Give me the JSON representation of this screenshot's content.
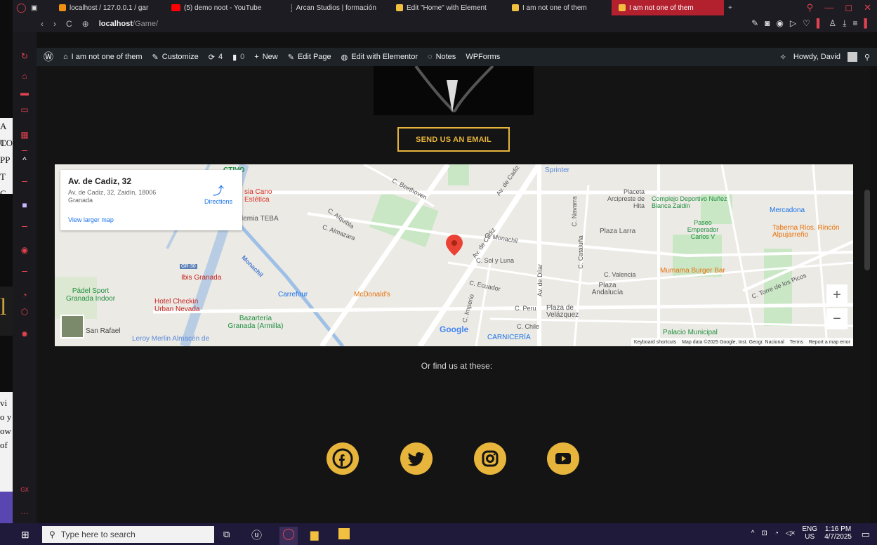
{
  "browser": {
    "tabs": [
      {
        "label": "localhost / 127.0.0.1 / gar",
        "color": "#f29111"
      },
      {
        "label": "(5) demo noot - YouTube",
        "color": "#ff0000"
      },
      {
        "label": "Arcan Studios | formación",
        "color": "#333333"
      },
      {
        "label": "Edit \"Home\" with Element",
        "color": "#f2c040"
      },
      {
        "label": "I am not one of them",
        "color": "#f2c040"
      },
      {
        "label": "I am not one of them",
        "color": "#f2c040",
        "active": true
      }
    ],
    "address": {
      "host": "localhost",
      "path": "/Game/"
    }
  },
  "wp_admin_bar": {
    "site_name": "I am not one of them",
    "customize": "Customize",
    "updates": "4",
    "comments": "0",
    "new": "New",
    "edit_page": "Edit Page",
    "edit_elementor": "Edit with Elementor",
    "notes": "Notes",
    "wpforms": "WPForms",
    "howdy": "Howdy, David"
  },
  "page": {
    "email_button": "SEND US AN EMAIL",
    "find_us": "Or find us at these:"
  },
  "map": {
    "place_title": "Av. de Cadiz, 32",
    "place_address": "Av. de Cadiz, 32, Zaidín, 18006 Granada",
    "directions": "Directions",
    "view_larger": "View larger map",
    "labels": {
      "sprinter": "Sprinter",
      "placeta": "Placeta Arcipreste de Hita",
      "complejo": "Complejo Deportivo Nuñez Blanca Zaidín",
      "mercadona": "Mercadona",
      "paseo": "Paseo Emperador Carlos V",
      "taberna": "Taberna Rios. Rincón Alpujarreño",
      "plaza_larra": "Plaza Larra",
      "mumama": "Mumama Burger Bar",
      "estetica": "sia Cano Estética",
      "teba": "lemia TEBA",
      "ibis": "Ibis Granada",
      "padel": "Pádel Sport Granada Indoor",
      "hotel": "Hotel Checkin Urban Nevada",
      "carrefour": "Carrefour",
      "mcdonalds": "McDonald's",
      "bazarteria": "Bazartería Granada (Armilla)",
      "leroy": "Leroy Merlin Almacén de",
      "san_rafael": "San Rafael",
      "plaza_andalucia": "Plaza Andalucía",
      "plaza_velazquez": "Plaza de Velázquez",
      "palacio": "Palacio Municipal",
      "carniceria": "CARNICERÍA",
      "c_beethoven": "C. Beethoven",
      "av_cadiz": "Av. de Cadiz",
      "c_monachil": "C. Monachil",
      "c_sol": "C. Sol y Luna",
      "c_ecuador": "C. Ecuador",
      "c_peru": "C. Peru",
      "c_chile": "C. Chile",
      "c_valencia": "C. Valencia",
      "c_torre": "C. Torre de los Picos",
      "av_dilar": "Av. de Dílar",
      "c_alquibla": "C. Alquibla",
      "c_almazara": "C. Almazara",
      "c_navarra": "C. Navarra",
      "c_cataluna": "C. Cataluña",
      "c_imperio": "C. Imperio",
      "monachil": "Monachil",
      "gr30": "GR-30",
      "ctivo": "CTIVO"
    },
    "footer": {
      "shortcuts": "Keyboard shortcuts",
      "mapdata": "Map data ©2025 Google, Inst. Geogr. Nacional",
      "terms": "Terms",
      "report": "Report a map error"
    },
    "google": "Google"
  },
  "social": [
    "facebook-icon",
    "twitter-icon",
    "instagram-icon",
    "youtube-icon"
  ],
  "taskbar": {
    "search_placeholder": "Type here to search",
    "lang": "ENG",
    "region": "US",
    "time": "1:16 PM",
    "date": "4/7/2025"
  },
  "background_text": [
    "A T",
    "CO",
    "PP",
    "T C",
    "vi",
    "o y",
    "ow",
    "of"
  ],
  "colors": {
    "accent": "#e7b53c",
    "opera_red": "#e0424f",
    "page_bg": "#141414"
  }
}
